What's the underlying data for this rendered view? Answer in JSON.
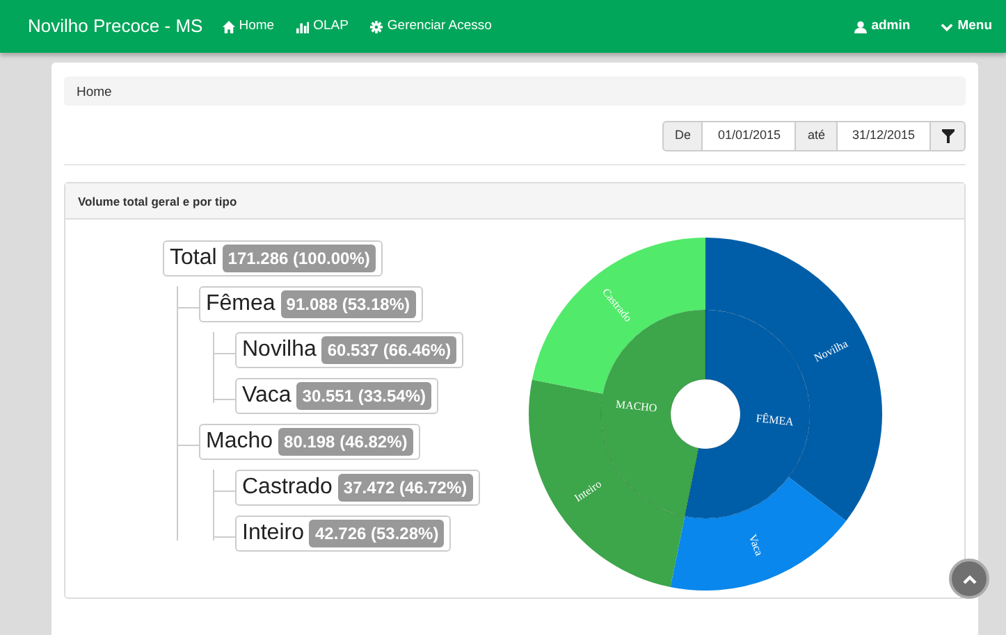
{
  "navbar": {
    "brand": "Novilho Precoce - MS",
    "links": [
      {
        "label": "Home"
      },
      {
        "label": "OLAP"
      },
      {
        "label": "Gerenciar Acesso"
      }
    ],
    "right": [
      {
        "label": "admin"
      },
      {
        "label": "Menu"
      }
    ]
  },
  "breadcrumb": [
    "Home"
  ],
  "date_filter": {
    "from_label": "De",
    "from": "01/01/2015",
    "to_label": "até",
    "to": "31/12/2015"
  },
  "card": {
    "title": "Volume total geral e por tipo",
    "tree": {
      "name": "Total",
      "count": "171.286 (100.00%)",
      "children": [
        {
          "name": "Fêmea",
          "count": "91.088 (53.18%)",
          "chart_label": "FÊMEA",
          "color": "#005ea8",
          "children": [
            {
              "name": "Novilha",
              "count": "60.537 (66.46%)",
              "chart_label": "Novilha",
              "color": "#005ea8"
            },
            {
              "name": "Vaca",
              "count": "30.551 (33.54%)",
              "chart_label": "Vaca",
              "color": "#0a87ec"
            }
          ]
        },
        {
          "name": "Macho",
          "count": "80.198 (46.82%)",
          "chart_label": "MACHO",
          "color": "#3da54a",
          "children": [
            {
              "name": "Castrado",
              "count": "37.472 (46.72%)",
              "chart_label": "Castrado",
              "color": "#52ea6b"
            },
            {
              "name": "Inteiro",
              "count": "42.726 (53.28%)",
              "chart_label": "Inteiro",
              "color": "#3da54a"
            }
          ]
        }
      ]
    }
  }
}
